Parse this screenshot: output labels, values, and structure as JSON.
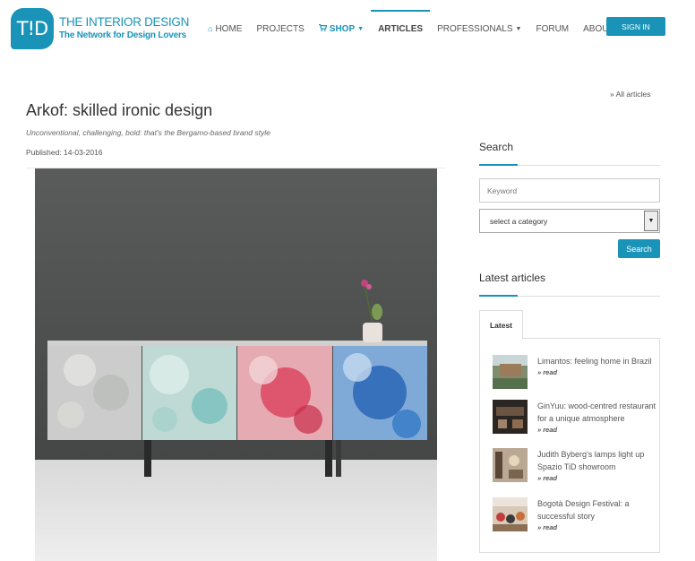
{
  "logo": {
    "badge": "T!D",
    "title": "THE INTERIOR DESIGN",
    "subtitle": "The Network for Design Lovers"
  },
  "nav": {
    "items": [
      {
        "label": "HOME",
        "icon": "home-icon"
      },
      {
        "label": "PROJECTS"
      },
      {
        "label": "SHOP",
        "icon": "cart-icon"
      },
      {
        "label": "ARTICLES"
      },
      {
        "label": "PROFESSIONALS"
      },
      {
        "label": "FORUM"
      },
      {
        "label": "ABOUT US"
      }
    ],
    "active": "ARTICLES",
    "signin": "SIGN IN"
  },
  "article": {
    "all_articles": "» All articles",
    "title": "Arkof: skilled ironic design",
    "subtitle": "Unconventional, challenging, bold: that's the Bergamo-based brand style",
    "published": "Published: 14-03-2016"
  },
  "sidebar": {
    "search_heading": "Search",
    "keyword_placeholder": "Keyword",
    "category_selected": "select a category",
    "search_button": "Search",
    "latest_heading": "Latest articles",
    "tab": "Latest",
    "items": [
      {
        "title": "Limantos: feeling home in Brazil",
        "read": "» read"
      },
      {
        "title": "GinYuu: wood-centred restaurant for a unique atmosphere",
        "read": "» read"
      },
      {
        "title": "Judith Byberg's lamps light up Spazio TiD showroom",
        "read": "» read"
      },
      {
        "title": "Bogotà Design Festival: a successful story",
        "read": "» read"
      }
    ]
  },
  "colors": {
    "accent": "#1a93b8"
  }
}
